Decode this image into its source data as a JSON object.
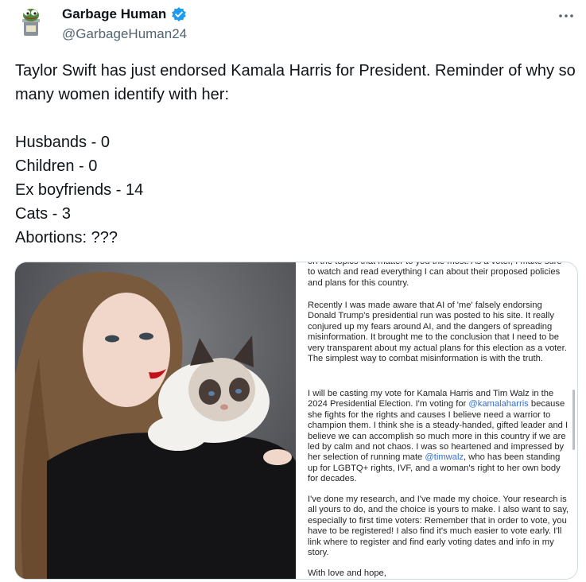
{
  "author": {
    "display_name": "Garbage Human",
    "handle": "@GarbageHuman24",
    "avatar_icon": "pepe-frog-in-trash-can-icon",
    "verified_icon": "verified-badge-icon",
    "verified_color": "#1d9bf0"
  },
  "more_options_icon": "ellipsis-icon",
  "tweet": {
    "text": "Taylor Swift has just endorsed Kamala Harris for President. Reminder of why so many women identify with her:\n\nHusbands - 0\nChildren - 0\nEx boyfriends - 14\nCats - 3\nAbortions: ???"
  },
  "media": {
    "photo_subject": "woman-holding-ragdoll-cat-photo",
    "statement": {
      "p0": "on the topics that matter to you the most. As a voter, I make sure to watch and read everything I can about their proposed policies and plans for this country.",
      "p1": "Recently I was made aware that AI of 'me' falsely endorsing Donald Trump's presidential run was posted to his site. It really conjured up my fears around AI, and the dangers of spreading misinformation. It brought me to the conclusion that I need to be very transparent about my actual plans for this election as a voter. The simplest way to combat misinformation is with the truth.",
      "p2_a": "I will be casting my vote for Kamala Harris and Tim Walz in the 2024 Presidential Election. I'm voting for ",
      "p2_mention1": "@kamalaharris",
      "p2_b": " because she fights for the rights and causes I believe need a warrior to champion them. I think she is a steady-handed, gifted leader and I believe we can accomplish so much more in this country if we are led by calm and not chaos. I was so heartened and impressed by her selection of running mate ",
      "p2_mention2": "@timwalz",
      "p2_c": ", who has been standing up for LGBTQ+ rights, IVF, and a woman's right to her own body for decades.",
      "p3": "I've done my research, and I've made my choice. Your research is all yours to do, and the choice is yours to make. I also want to say, especially to first time voters: Remember that in order to vote, you have to be registered! I also find it's much easier to vote early. I'll link where to register and find early voting dates and info in my story.",
      "p4": "With love and hope,",
      "mention_color": "#2f6fdb"
    }
  }
}
